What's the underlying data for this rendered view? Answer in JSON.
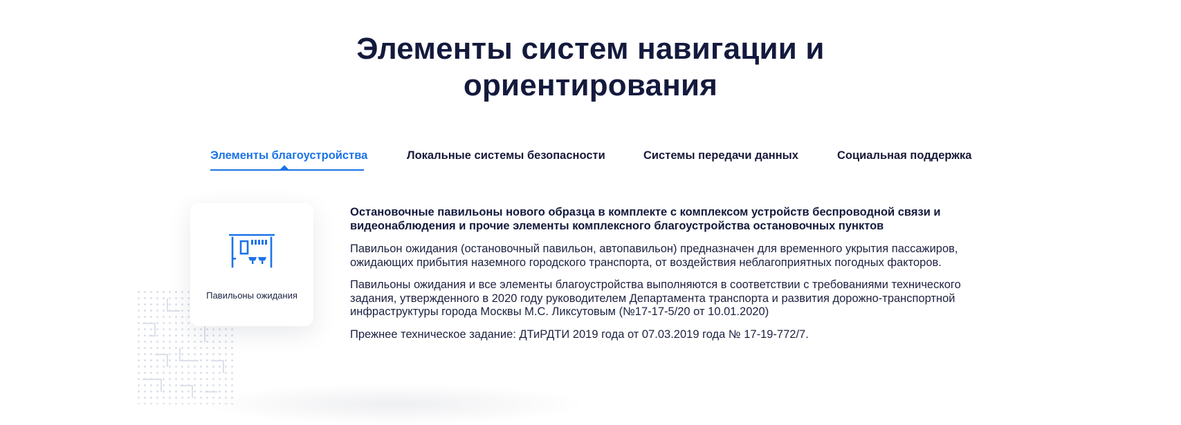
{
  "page": {
    "title_line1": "Элементы систем навигации и",
    "title_line2": "ориентирования"
  },
  "tabs": [
    {
      "label": "Элементы благоустройства",
      "active": true
    },
    {
      "label": "Локальные системы безопасности",
      "active": false
    },
    {
      "label": "Системы передачи данных",
      "active": false
    },
    {
      "label": "Социальная поддержка",
      "active": false
    }
  ],
  "card": {
    "icon": "bus-stop-pavilion-icon",
    "label": "Павильоны ожидания"
  },
  "content": {
    "lead": "Остановочные павильоны нового образца в комплекте с комплексом устройств беспроводной связи и видеонаблюдения и прочие элементы комплексного благоустройства остановочных пунктов",
    "paragraph1": "Павильон ожидания (остановочный павильон, автопавильон) предназначен для временного укрытия пассажиров, ожидающих прибытия наземного городского транспорта, от воздействия неблагоприятных погодных факторов.",
    "paragraph2": "Павильоны ожидания и все элементы благоустройства выполняются в соответствии с требованиями технического задания, утвержденного в 2020 году руководителем Департамента транспорта и развития дорожно-транспортной инфраструктуры города Москвы М.С. Ликсутовым (№17-17-5/20 от 10.01.2020)",
    "paragraph3": "Прежнее техническое задание:  ДТиРДТИ 2019 года от 07.03.2019 года № 17-19-772/7."
  },
  "colors": {
    "accent": "#1a73e8",
    "heading": "#141a3d",
    "text": "#1d2140"
  }
}
